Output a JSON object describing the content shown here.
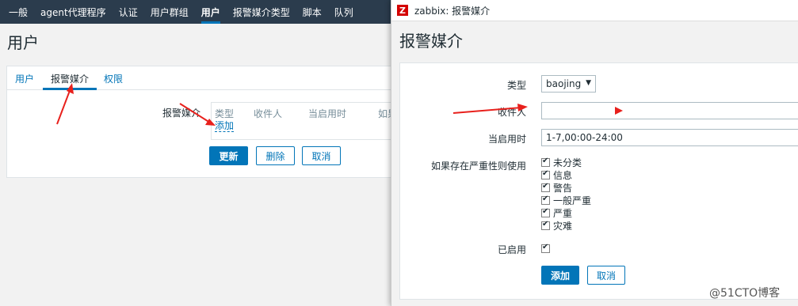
{
  "topnav": {
    "items": [
      {
        "label": "一般",
        "active": false
      },
      {
        "label": "agent代理程序",
        "active": false
      },
      {
        "label": "认证",
        "active": false
      },
      {
        "label": "用户群组",
        "active": false
      },
      {
        "label": "用户",
        "active": true
      },
      {
        "label": "报警媒介类型",
        "active": false
      },
      {
        "label": "脚本",
        "active": false
      },
      {
        "label": "队列",
        "active": false
      }
    ]
  },
  "page": {
    "title": "用户",
    "tabs": {
      "user": "用户",
      "media": "报警媒介",
      "permissions": "权限"
    },
    "media": {
      "label": "报警媒介",
      "columns": {
        "type": "类型",
        "send_to": "收件人",
        "when_active": "当启用时",
        "severity": "如果"
      },
      "add_link": "添加"
    },
    "buttons": {
      "update": "更新",
      "delete": "删除",
      "cancel": "取消"
    }
  },
  "popup": {
    "window_title": "zabbix: 报警媒介",
    "app_icon_letter": "Z",
    "heading": "报警媒介",
    "form": {
      "type_label": "类型",
      "type_value": "baojing",
      "send_to_label": "收件人",
      "send_to_value": "",
      "when_active_label": "当启用时",
      "when_active_value": "1-7,00:00-24:00",
      "severity_label": "如果存在严重性则使用",
      "severities": [
        {
          "label": "未分类",
          "checked": true
        },
        {
          "label": "信息",
          "checked": true
        },
        {
          "label": "警告",
          "checked": true
        },
        {
          "label": "一般严重",
          "checked": true
        },
        {
          "label": "严重",
          "checked": true
        },
        {
          "label": "灾难",
          "checked": true
        }
      ],
      "enabled_label": "已启用",
      "enabled_checked": true
    },
    "buttons": {
      "add": "添加",
      "cancel": "取消"
    }
  },
  "watermark": "@51CTO博客",
  "colors": {
    "nav_bg": "#2b3c4d",
    "accent": "#0275b8",
    "annotation_red": "#e8201c",
    "zabbix_red": "#d40000"
  }
}
